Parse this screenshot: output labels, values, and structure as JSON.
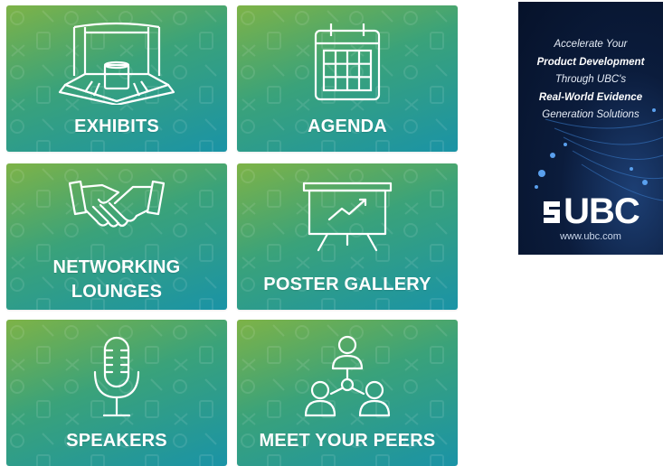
{
  "tiles": {
    "exhibits": "EXHIBITS",
    "agenda": "AGENDA",
    "networking_line1": "NETWORKING",
    "networking_line2": "LOUNGES",
    "poster_gallery": "POSTER GALLERY",
    "speakers": "SPEAKERS",
    "meet_peers": "MEET YOUR PEERS"
  },
  "ad": {
    "line1": "Accelerate Your",
    "line2": "Product Development",
    "line3": "Through UBC's",
    "line4": "Real-World Evidence",
    "line5": "Generation Solutions",
    "logo": "UBC",
    "url": "www.ubc.com"
  },
  "colors": {
    "tile_gradient_start": "#7eb347",
    "tile_gradient_end": "#1a93a6",
    "ad_background": "#0b1c3c"
  },
  "icons": {
    "exhibits": "booth-icon",
    "agenda": "calendar-icon",
    "networking": "handshake-icon",
    "poster_gallery": "presentation-board-icon",
    "speakers": "microphone-icon",
    "meet_peers": "people-network-icon"
  }
}
